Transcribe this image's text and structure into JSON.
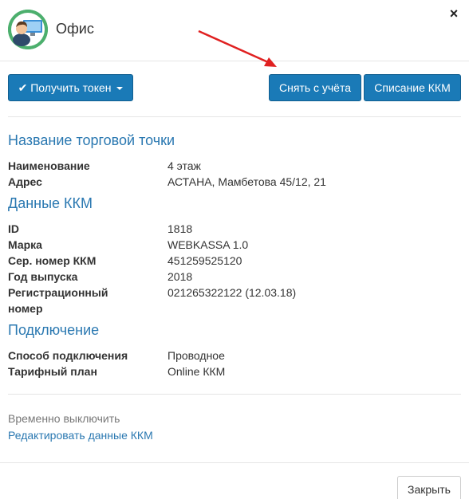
{
  "header": {
    "title": "Офис",
    "avatar_icon": "office-worker-avatar-icon",
    "close_icon": "close-icon"
  },
  "toolbar": {
    "token_label": "Получить токен",
    "deregister_label": "Снять с учёта",
    "writeoff_label": "Списание ККМ",
    "accent_color": "#1a7ab7"
  },
  "outlet": {
    "heading": "Название торговой точки",
    "rows": [
      {
        "label": "Наименование",
        "value": "4 этаж"
      },
      {
        "label": "Адрес",
        "value": "АСТАНА, Мамбетова 45/12, 21"
      }
    ]
  },
  "kkm": {
    "heading": "Данные ККМ",
    "rows": [
      {
        "label": "ID",
        "value": "1818"
      },
      {
        "label": "Марка",
        "value": "WEBKASSA 1.0"
      },
      {
        "label": "Сер. номер ККМ",
        "value": "451259525120"
      },
      {
        "label": "Год выпуска",
        "value": "2018"
      },
      {
        "label": "Регистрационный номер",
        "value": "021265322122 (12.03.18)"
      }
    ]
  },
  "connection": {
    "heading": "Подключение",
    "rows": [
      {
        "label": "Способ подключения",
        "value": "Проводное"
      },
      {
        "label": "Тарифный план",
        "value": "Online ККМ"
      }
    ]
  },
  "actions": {
    "disable_text": "Временно выключить",
    "edit_link": "Редактировать данные ККМ"
  },
  "footer": {
    "close_label": "Закрыть"
  },
  "annotation": {
    "arrow_color": "#e02020"
  }
}
